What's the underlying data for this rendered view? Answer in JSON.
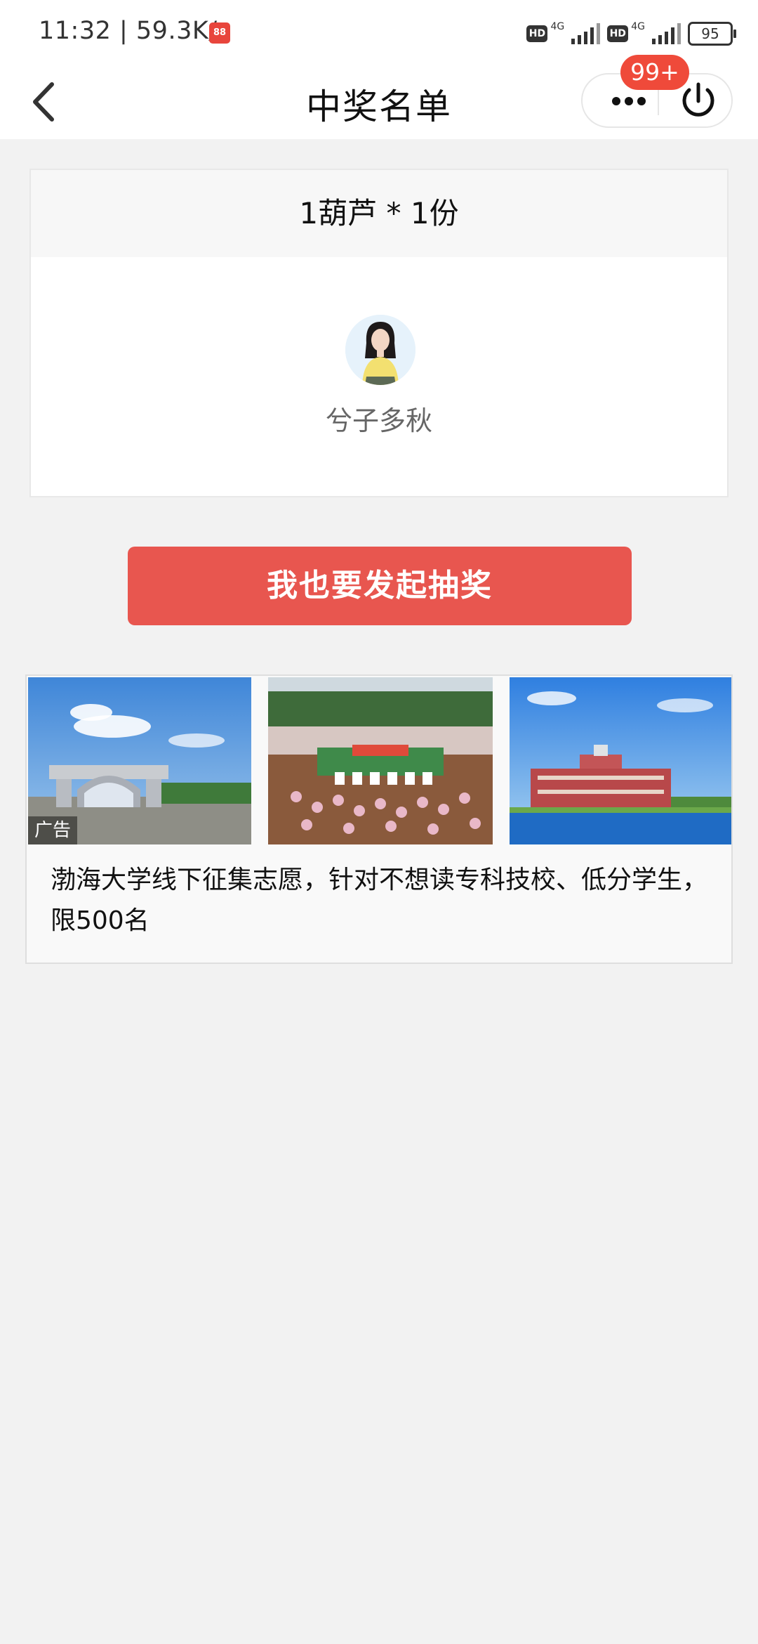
{
  "status_bar": {
    "time": "11:32 | 59.3K/s",
    "app_icon_label": "88",
    "sim1_hd": "HD",
    "sim1_net": "4G",
    "sim2_hd": "HD",
    "sim2_net": "4G",
    "battery": "95"
  },
  "nav": {
    "title": "中奖名单",
    "badge": "99+",
    "icons": [
      "back-arrow-icon",
      "more-icon",
      "power-icon"
    ]
  },
  "prize": {
    "header": "1葫芦 * 1份",
    "winner_name": "兮子多秋"
  },
  "cta": {
    "label": "我也要发起抽奖",
    "color": "#e8564f"
  },
  "ad": {
    "tag": "广告",
    "text": "渤海大学线下征集志愿，针对不想读专科技校、低分学生，限500名"
  },
  "colors": {
    "badge": "#ef4a3a",
    "background": "#f2f2f2"
  }
}
